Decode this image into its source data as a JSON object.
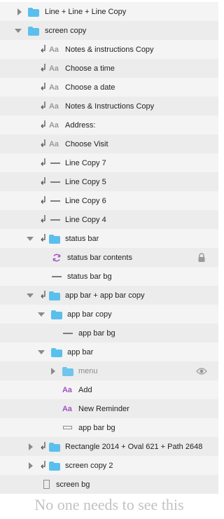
{
  "layers": [
    {
      "label": "Line + Line + Line Copy",
      "icon": "folder-icon"
    },
    {
      "label": "screen copy",
      "icon": "folder-icon"
    },
    {
      "label": "Notes & instructions Copy",
      "icon": "text-layer-icon",
      "icon_text": "Aa"
    },
    {
      "label": "Choose a time",
      "icon": "text-layer-icon",
      "icon_text": "Aa"
    },
    {
      "label": "Choose a date",
      "icon": "text-layer-icon",
      "icon_text": "Aa"
    },
    {
      "label": "Notes & Instructions Copy",
      "icon": "text-layer-icon",
      "icon_text": "Aa"
    },
    {
      "label": "Address:",
      "icon": "text-layer-icon",
      "icon_text": "Aa"
    },
    {
      "label": "Choose Visit",
      "icon": "text-layer-icon",
      "icon_text": "Aa"
    },
    {
      "label": "Line Copy 7",
      "icon": "line-layer-icon"
    },
    {
      "label": "Line Copy 5",
      "icon": "line-layer-icon"
    },
    {
      "label": "Line Copy 6",
      "icon": "line-layer-icon"
    },
    {
      "label": "Line Copy 4",
      "icon": "line-layer-icon"
    },
    {
      "label": "status bar",
      "icon": "folder-icon"
    },
    {
      "label": "status bar contents",
      "icon": "symbol-icon"
    },
    {
      "label": "status bar bg",
      "icon": "line-layer-icon"
    },
    {
      "label": "app bar + app bar copy",
      "icon": "folder-icon"
    },
    {
      "label": "app bar copy",
      "icon": "folder-icon"
    },
    {
      "label": "app bar bg",
      "icon": "line-layer-icon"
    },
    {
      "label": "app bar",
      "icon": "folder-icon"
    },
    {
      "label": "menu",
      "icon": "folder-icon"
    },
    {
      "label": "Add",
      "icon": "text-layer-icon",
      "icon_text": "Aa"
    },
    {
      "label": "New Reminder",
      "icon": "text-layer-icon",
      "icon_text": "Aa"
    },
    {
      "label": "app bar bg",
      "icon": "rectangle-layer-icon"
    },
    {
      "label": "Rectangle 2014 + Oval 621 + Path 2648",
      "icon": "folder-icon"
    },
    {
      "label": "screen copy 2",
      "icon": "folder-icon"
    },
    {
      "label": "screen bg",
      "icon": "artboard-icon"
    }
  ],
  "footer_text": "No one needs to see this",
  "colors": {
    "folder": "#5bbfee",
    "text_icon_purple": "#a350c6",
    "text_icon_gray": "#9b9b9b"
  }
}
